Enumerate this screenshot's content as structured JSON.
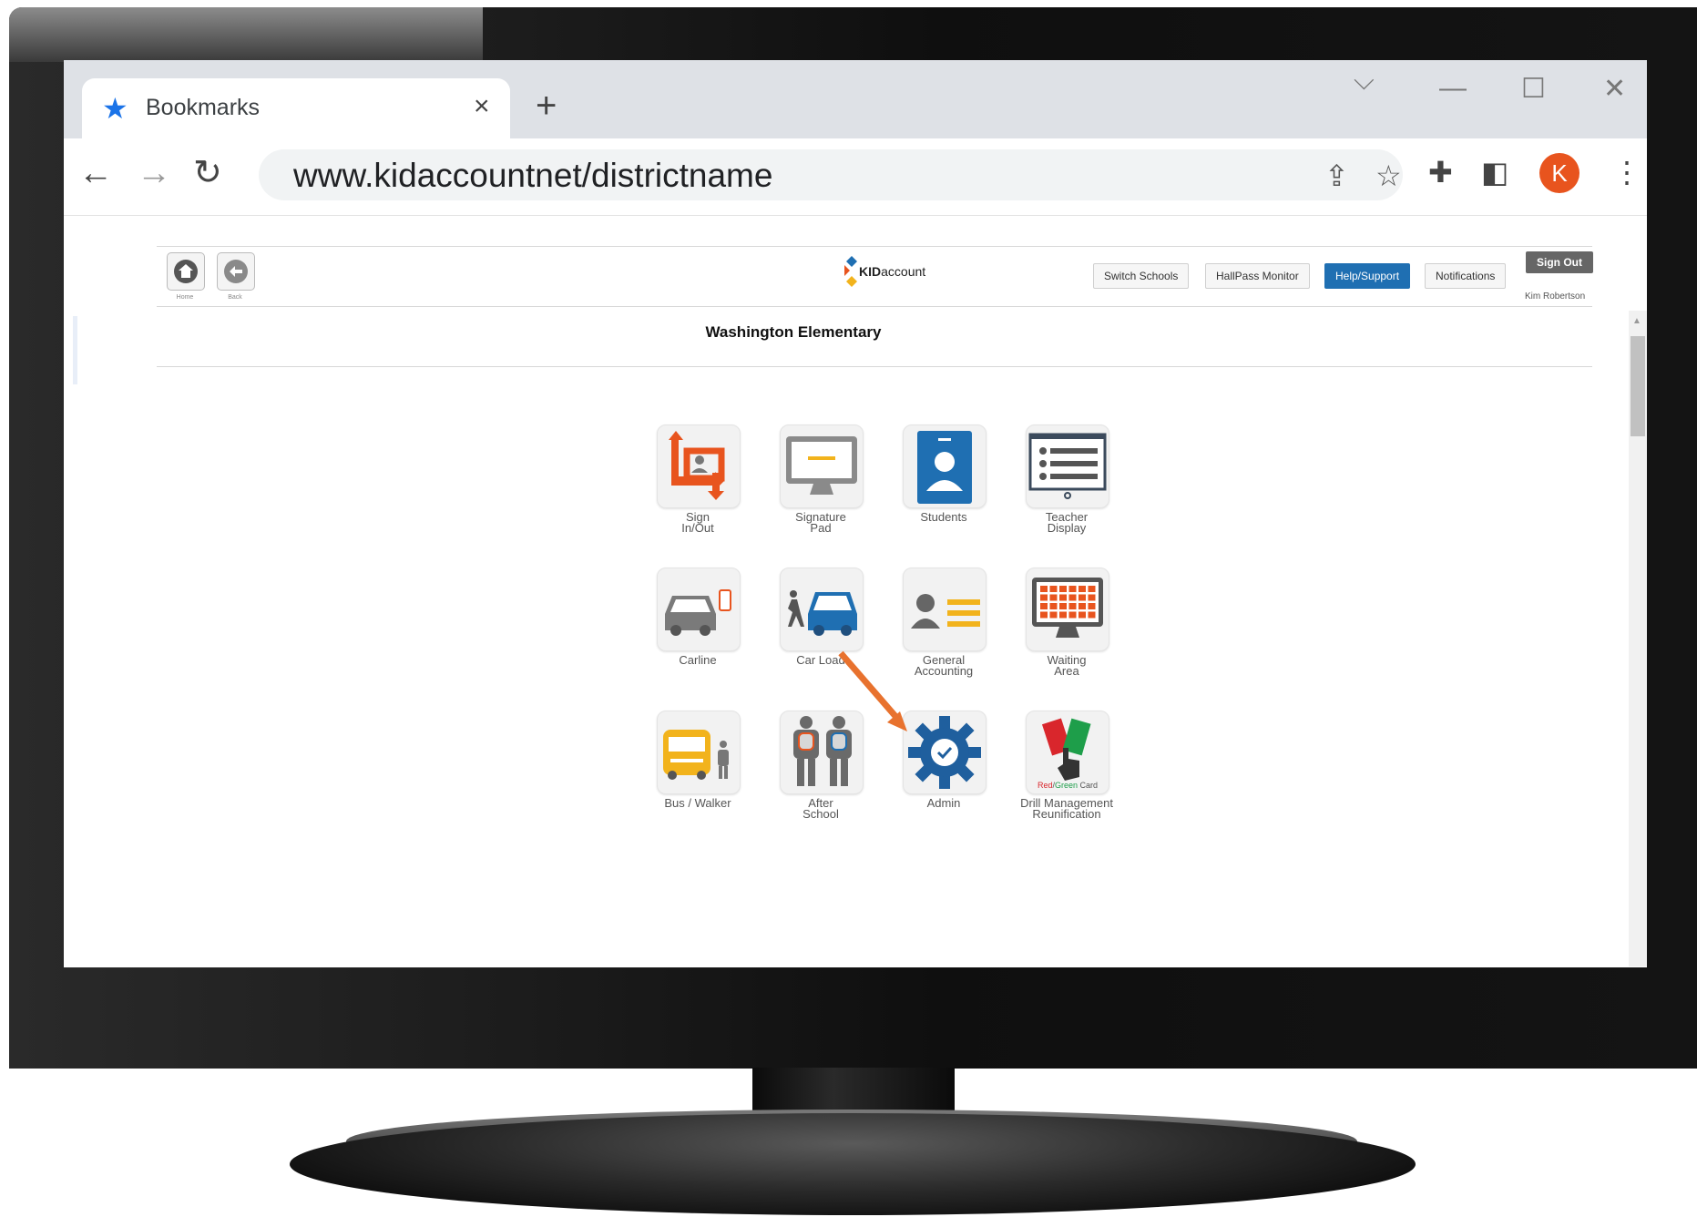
{
  "browser": {
    "tab_title": "Bookmarks",
    "tab_close": "×",
    "new_tab": "+",
    "url": "www.kidaccountnet/districtname",
    "avatar_letter": "K",
    "icons": [
      "star-icon",
      "back-arrow-icon",
      "forward-arrow-icon",
      "reload-icon",
      "share-icon",
      "bookmark-star-icon",
      "extensions-icon",
      "side-panel-icon",
      "kebab-menu-icon",
      "minimize-icon",
      "maximize-icon",
      "close-icon",
      "tab-search-chevron-icon"
    ]
  },
  "header": {
    "home_caption": "Home",
    "back_caption": "Back",
    "logo_bold": "KID",
    "logo_rest": "account",
    "buttons": {
      "switch_schools": "Switch Schools",
      "hallpass": "HallPass Monitor",
      "help": "Help/Support",
      "notifications": "Notifications",
      "sign_out": "Sign Out"
    },
    "user_name": "Kim Robertson",
    "school_name": "Washington Elementary"
  },
  "tiles": {
    "sign_in_out": {
      "line1": "Sign",
      "line2": "In/Out"
    },
    "signature_pad": {
      "line1": "Signature",
      "line2": "Pad"
    },
    "students": {
      "line1": "Students"
    },
    "teacher_display": {
      "line1": "Teacher",
      "line2": "Display"
    },
    "carline": {
      "line1": "Carline"
    },
    "car_load": {
      "line1": "Car Load"
    },
    "general_accounting": {
      "line1": "General",
      "line2": "Accounting"
    },
    "waiting_area": {
      "line1": "Waiting",
      "line2": "Area"
    },
    "bus_walker": {
      "line1": "Bus / Walker"
    },
    "after_school": {
      "line1": "After",
      "line2": "School"
    },
    "admin": {
      "line1": "Admin"
    },
    "drill": {
      "line1": "Drill Management",
      "line2": "Reunification",
      "card_red": "Red",
      "card_slash": "/",
      "card_green": "Green",
      "card_rest": " Card"
    }
  },
  "colors": {
    "accent_blue": "#1f6fb2",
    "orange": "#e8541e",
    "annotation_arrow": "#e8722e"
  }
}
